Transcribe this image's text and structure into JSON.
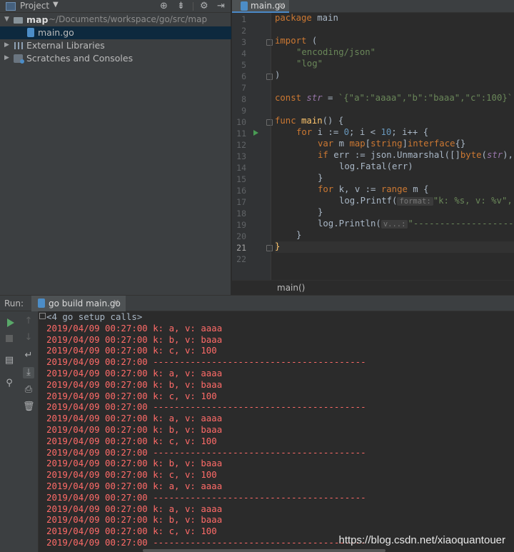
{
  "project_panel": {
    "title": "Project",
    "tree": [
      {
        "label": "map",
        "path": "~/Documents/workspace/go/src/map"
      },
      {
        "label": "main.go"
      },
      {
        "label": "External Libraries"
      },
      {
        "label": "Scratches and Consoles"
      }
    ]
  },
  "editor": {
    "tab_label": "main.go",
    "breadcrumb": "main()",
    "line_numbers": [
      "1",
      "2",
      "3",
      "4",
      "5",
      "6",
      "7",
      "8",
      "9",
      "10",
      "11",
      "12",
      "13",
      "14",
      "15",
      "16",
      "17",
      "18",
      "19",
      "20",
      "21",
      "22"
    ],
    "code": {
      "l1": [
        "package",
        " main"
      ],
      "l3": [
        "import",
        " ("
      ],
      "l4": "\"encoding/json\"",
      "l5": "\"log\"",
      "l6": ")",
      "l8": [
        "const ",
        "str",
        " = ",
        "`{\"a\":\"aaaa\",\"b\":\"baaa\",\"c\":100}`"
      ],
      "l10": [
        "func ",
        "main",
        "() {"
      ],
      "l11": [
        "for",
        " i := ",
        "0",
        "; i < ",
        "10",
        "; i++ {"
      ],
      "l12": [
        "var",
        " m ",
        "map",
        "[",
        "string",
        "]",
        "interface",
        "{}"
      ],
      "l13": [
        "if",
        " err := json.Unmarshal([]",
        "byte",
        "(",
        "str",
        "),"
      ],
      "l14": "log.Fatal(err)",
      "l15": "}",
      "l16": [
        "for",
        " k, v := ",
        "range",
        " m {"
      ],
      "l17": [
        "log.Printf(",
        "format:",
        "\"k: %s, v: %v\","
      ],
      "l18": "}",
      "l19": [
        "log.Println(",
        "v...:",
        "\"------------------------"
      ],
      "l20": "}",
      "l21": "}"
    }
  },
  "run": {
    "title": "Run:",
    "tab_label": "go build main.go",
    "setup_line": "<4 go setup calls>",
    "output": [
      "2019/04/09 00:27:00 k: a, v: aaaa",
      "2019/04/09 00:27:00 k: b, v: baaa",
      "2019/04/09 00:27:00 k: c, v: 100",
      "2019/04/09 00:27:00 ----------------------------------------",
      "2019/04/09 00:27:00 k: a, v: aaaa",
      "2019/04/09 00:27:00 k: b, v: baaa",
      "2019/04/09 00:27:00 k: c, v: 100",
      "2019/04/09 00:27:00 ----------------------------------------",
      "2019/04/09 00:27:00 k: a, v: aaaa",
      "2019/04/09 00:27:00 k: b, v: baaa",
      "2019/04/09 00:27:00 k: c, v: 100",
      "2019/04/09 00:27:00 ----------------------------------------",
      "2019/04/09 00:27:00 k: b, v: baaa",
      "2019/04/09 00:27:00 k: c, v: 100",
      "2019/04/09 00:27:00 k: a, v: aaaa",
      "2019/04/09 00:27:00 ----------------------------------------",
      "2019/04/09 00:27:00 k: a, v: aaaa",
      "2019/04/09 00:27:00 k: b, v: baaa",
      "2019/04/09 00:27:00 k: c, v: 100",
      "2019/04/09 00:27:00 ----------------------------------------"
    ]
  },
  "watermark": "https://blog.csdn.net/xiaoquantouer",
  "colors": {
    "keyword": "#cc7832",
    "string": "#6a8759",
    "function": "#ffc66d",
    "number": "#6897bb",
    "console_output": "#ff6b68"
  }
}
